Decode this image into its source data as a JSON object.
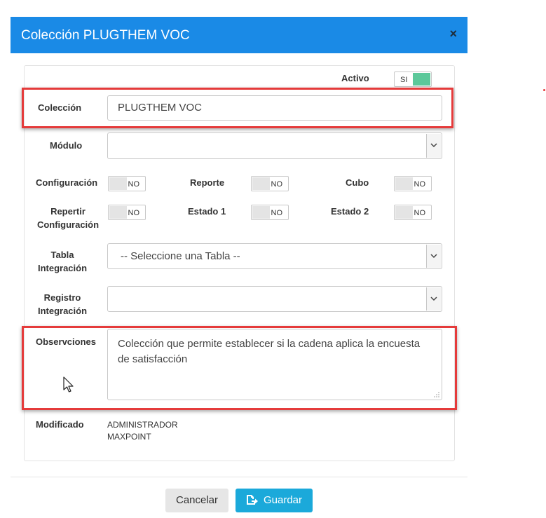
{
  "modal": {
    "title": "Colección PLUGTHEM VOC",
    "close_label": "×"
  },
  "activo": {
    "label": "Activo",
    "state": "SI"
  },
  "coleccion": {
    "label": "Colección",
    "value": "PLUGTHEM VOC"
  },
  "modulo": {
    "label": "Módulo",
    "value": ""
  },
  "toggles": {
    "configuracion": {
      "label": "Configuración",
      "state": "NO"
    },
    "reporte": {
      "label": "Reporte",
      "state": "NO"
    },
    "cubo": {
      "label": "Cubo",
      "state": "NO"
    },
    "repertir": {
      "label1": "Repertir",
      "label2": "Configuración",
      "state": "NO"
    },
    "estado1": {
      "label": "Estado 1",
      "state": "NO"
    },
    "estado2": {
      "label": "Estado 2",
      "state": "NO"
    }
  },
  "tabla_integracion": {
    "label1": "Tabla",
    "label2": "Integración",
    "value": "-- Seleccione una Tabla --"
  },
  "registro_integracion": {
    "label1": "Registro",
    "label2": "Integración",
    "value": ""
  },
  "observaciones": {
    "label": "Observciones",
    "value": "Colección que permite establecer si la cadena aplica la encuesta de satisfacción"
  },
  "modificado": {
    "label": "Modificado",
    "line1": "ADMINISTRADOR",
    "line2": "MAXPOINT"
  },
  "footer": {
    "cancel_label": "Cancelar",
    "save_label": "Guardar"
  },
  "colors": {
    "header": "#1a8ae6",
    "toggle_on": "#5cc89a",
    "save_button": "#1ba9da",
    "highlight": "#e53b3b"
  },
  "icons": {
    "close": "close-icon",
    "save": "save-arrow-icon",
    "select_arrow": "chevron-down-icon",
    "cursor": "mouse-pointer-icon"
  }
}
